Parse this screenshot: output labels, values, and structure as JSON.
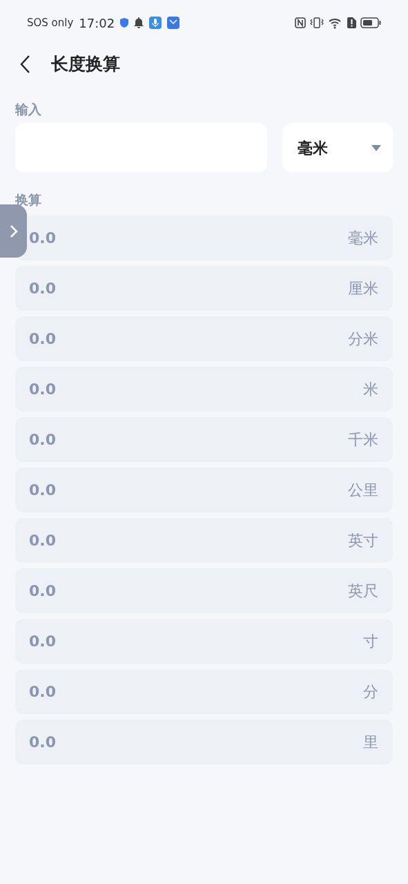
{
  "status_bar": {
    "carrier": "SOS only",
    "time": "17:02"
  },
  "header": {
    "title": "长度换算"
  },
  "input": {
    "label": "输入",
    "unit": "毫米"
  },
  "results": {
    "label": "换算",
    "rows": [
      {
        "value": "0.0",
        "unit": "毫米"
      },
      {
        "value": "0.0",
        "unit": "厘米"
      },
      {
        "value": "0.0",
        "unit": "分米"
      },
      {
        "value": "0.0",
        "unit": "米"
      },
      {
        "value": "0.0",
        "unit": "千米"
      },
      {
        "value": "0.0",
        "unit": "公里"
      },
      {
        "value": "0.0",
        "unit": "英寸"
      },
      {
        "value": "0.0",
        "unit": "英尺"
      },
      {
        "value": "0.0",
        "unit": "寸"
      },
      {
        "value": "0.0",
        "unit": "分"
      },
      {
        "value": "0.0",
        "unit": "里"
      }
    ]
  }
}
